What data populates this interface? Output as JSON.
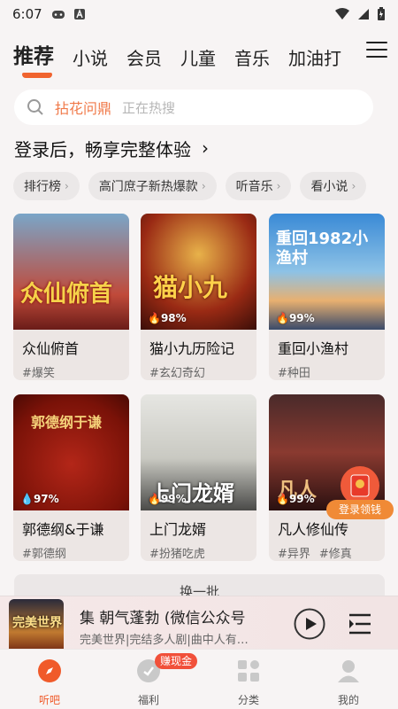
{
  "status_bar": {
    "time": "6:07"
  },
  "tabs": [
    {
      "label": "推荐",
      "active": true
    },
    {
      "label": "小说"
    },
    {
      "label": "会员"
    },
    {
      "label": "儿童"
    },
    {
      "label": "音乐"
    },
    {
      "label": "加油打"
    }
  ],
  "search": {
    "query": "拈花问鼎",
    "hint": "正在热搜"
  },
  "login_prompt": {
    "text": "登录后，畅享完整体验",
    "arrow": "›"
  },
  "chips": [
    "排行榜",
    "高门庶子新热爆款",
    "听音乐",
    "看小说"
  ],
  "chip_arrow": "›",
  "cards": [
    {
      "title": "众仙俯首",
      "tags": [
        "#爆笑"
      ],
      "cover_text": "众仙俯首",
      "pct": ""
    },
    {
      "title": "猫小九历险记",
      "tags": [
        "#玄幻奇幻"
      ],
      "cover_text": "猫小九",
      "pct": "98%"
    },
    {
      "title": "重回小渔村",
      "tags": [
        "#种田"
      ],
      "cover_text": "重回1982小渔村",
      "pct": "99%"
    },
    {
      "title": "郭德纲&于谦",
      "tags": [
        "#郭德纲"
      ],
      "cover_text": "郭德纲于谦",
      "pct": "97%"
    },
    {
      "title": "上门龙婿",
      "tags": [
        "#扮猪吃虎"
      ],
      "cover_text": "上门龙婿",
      "pct": "99%"
    },
    {
      "title": "凡人修仙传",
      "tags": [
        "#异界",
        "#修真"
      ],
      "cover_text": "凡人",
      "pct": "99%"
    }
  ],
  "gift": {
    "label": "登录领钱"
  },
  "more_button": {
    "label": "换一批"
  },
  "player": {
    "title": "集 朝气蓬勃 (微信公众号",
    "subtitle": "完美世界|完结多人剧|曲中人有…",
    "cover_text": "完美世界"
  },
  "bottom_nav": [
    {
      "label": "听吧",
      "active": true
    },
    {
      "label": "福利"
    },
    {
      "label": "分类"
    },
    {
      "label": "我的"
    }
  ],
  "nav_badge": "赚现金",
  "colors": {
    "accent": "#f05a2a",
    "badge": "#f1503a",
    "gift_label": "#f08a36"
  }
}
